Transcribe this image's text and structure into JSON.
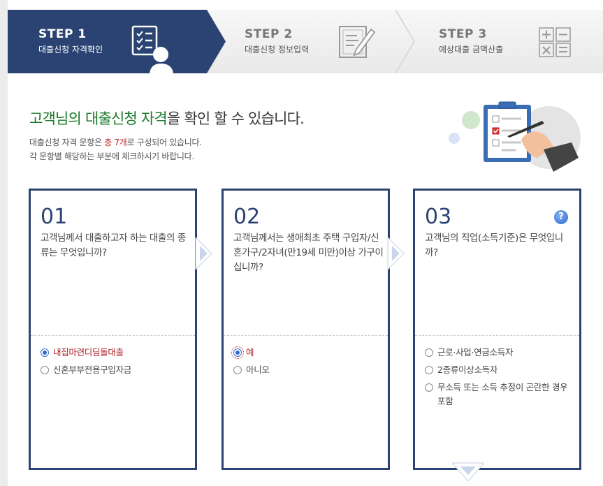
{
  "steps": [
    {
      "title": "STEP 1",
      "subtitle": "대출신청 자격확인",
      "icon": "checklist-person-icon",
      "active": true
    },
    {
      "title": "STEP 2",
      "subtitle": "대출신청 정보입력",
      "icon": "form-pen-icon",
      "active": false
    },
    {
      "title": "STEP 3",
      "subtitle": "예상대출 금액산출",
      "icon": "calculator-icon",
      "active": false
    }
  ],
  "headline": {
    "part1": "고객님의 대출신청 자격",
    "part2": "을 확인 할 수 있습니다."
  },
  "description": {
    "line1_a": "대출신청 자격 문항은 ",
    "line1_b": "총 7개",
    "line1_c": "로 구성되어 있습니다.",
    "line2": "각 문항별 해당하는 부분에 체크하시기 바랍니다."
  },
  "questions": [
    {
      "number": "01",
      "text": "고객님께서 대출하고자 하는 대출의 종류는 무엇입니까?",
      "options": [
        {
          "label": "내집마련디딤돌대출",
          "selected": true
        },
        {
          "label": "신혼부부전용구입자금",
          "selected": false
        }
      ]
    },
    {
      "number": "02",
      "text": "고객님께서는 생애최초 주택 구입자/신혼가구/2자녀(만19세 미만)이상 가구이십니까?",
      "options": [
        {
          "label": "예",
          "selected": true
        },
        {
          "label": "아니오",
          "selected": false
        }
      ]
    },
    {
      "number": "03",
      "text": "고객님의 직업(소득기준)은 무엇입니까?",
      "help": "?",
      "options": [
        {
          "label": "근로·사업·연금소득자",
          "selected": false
        },
        {
          "label": "2종류이상소득자",
          "selected": false
        },
        {
          "label": "무소득 또는 소득 추정이 곤란한 경우 포함",
          "selected": false
        }
      ]
    }
  ],
  "colors": {
    "active_step": "#2b4373",
    "card_border": "#2b4373",
    "headline_green": "#1a7b2a",
    "highlight_red": "#c0262d"
  }
}
